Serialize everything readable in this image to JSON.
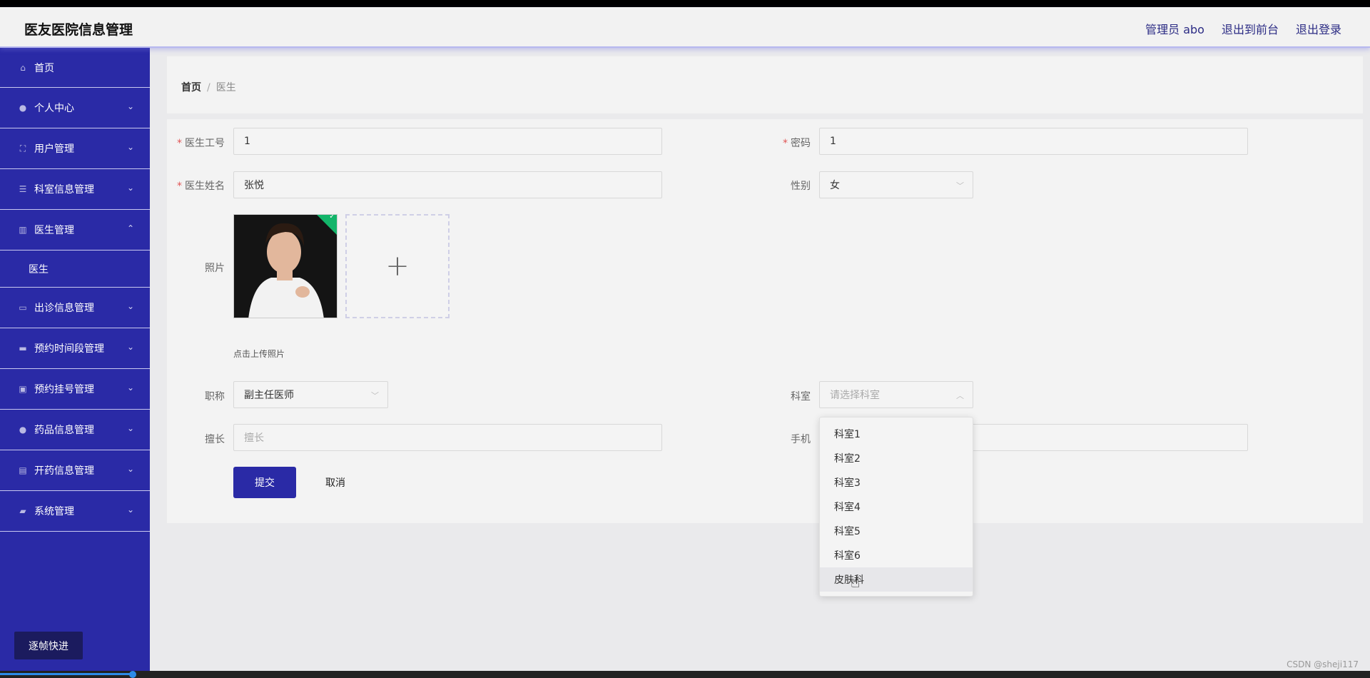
{
  "header": {
    "brand": "医友医院信息管理",
    "links": [
      "管理员 abo",
      "退出到前台",
      "退出登录"
    ]
  },
  "sidebar": {
    "items": [
      {
        "label": "首页",
        "icon": "home-icon",
        "chev": ""
      },
      {
        "label": "个人中心",
        "icon": "user-icon",
        "chev": "⌄"
      },
      {
        "label": "用户管理",
        "icon": "frame-icon",
        "chev": "⌄"
      },
      {
        "label": "科室信息管理",
        "icon": "menu-icon",
        "chev": "⌄"
      },
      {
        "label": "医生管理",
        "icon": "chart-icon",
        "chev": "⌃"
      },
      {
        "label": "出诊信息管理",
        "icon": "chat-icon",
        "chev": "⌄"
      },
      {
        "label": "预约时间段管理",
        "icon": "briefcase-icon",
        "chev": "⌄"
      },
      {
        "label": "预约挂号管理",
        "icon": "message-icon",
        "chev": "⌄"
      },
      {
        "label": "药品信息管理",
        "icon": "user-icon",
        "chev": "⌄"
      },
      {
        "label": "开药信息管理",
        "icon": "clipboard-icon",
        "chev": "⌄"
      },
      {
        "label": "系统管理",
        "icon": "thumb-icon",
        "chev": "⌄"
      }
    ],
    "subitem": "医生",
    "frame_button": "逐帧快进"
  },
  "breadcrumb": {
    "home": "首页",
    "sep": "/",
    "current": "医生"
  },
  "form": {
    "doctor_id_label": "医生工号",
    "doctor_id_value": "1",
    "password_label": "密码",
    "password_value": "1",
    "name_label": "医生姓名",
    "name_value": "张悦",
    "gender_label": "性别",
    "gender_value": "女",
    "photo_label": "照片",
    "upload_hint": "点击上传照片",
    "title_label": "职称",
    "title_value": "副主任医师",
    "dept_label": "科室",
    "dept_placeholder": "请选择科室",
    "specialty_label": "擅长",
    "specialty_placeholder": "擅长",
    "phone_label": "手机",
    "required_mark": "*",
    "submit": "提交",
    "cancel": "取消"
  },
  "dropdown": {
    "options": [
      "科室1",
      "科室2",
      "科室3",
      "科室4",
      "科室5",
      "科室6",
      "皮肤科"
    ],
    "hovered": "皮肤科"
  },
  "watermark": "CSDN @sheji117",
  "colors": {
    "sidebar": "#2a2aa6",
    "accent": "#2a2aa6",
    "success_badge": "#13b56a"
  }
}
